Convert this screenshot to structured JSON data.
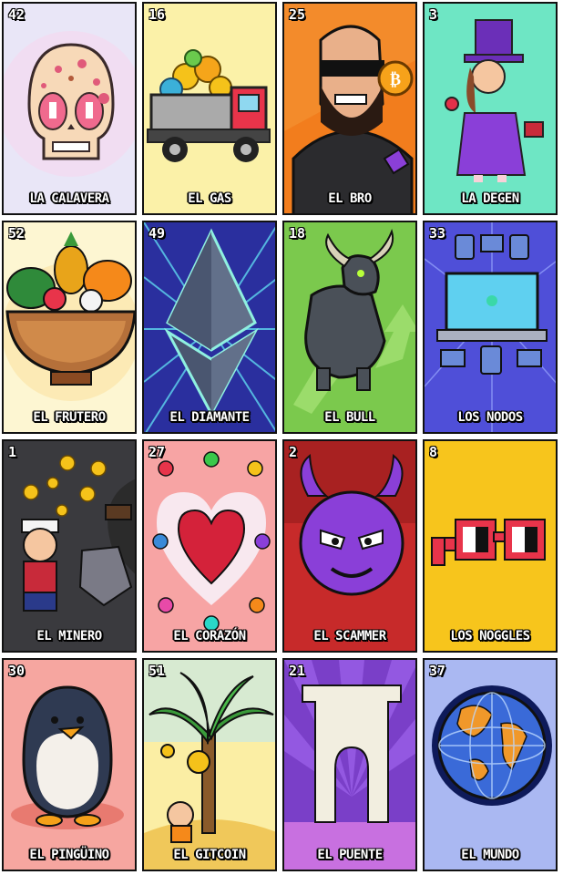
{
  "cards": [
    {
      "number": "42",
      "name": "LA CALAVERA",
      "bg": "#e9e6f7",
      "icon": "skull-icon"
    },
    {
      "number": "16",
      "name": "EL GAS",
      "bg": "#fbf1a8",
      "icon": "truck-icon"
    },
    {
      "number": "25",
      "name": "EL BRO",
      "bg": "#f27d1d",
      "icon": "bro-icon"
    },
    {
      "number": "3",
      "name": "LA DEGEN",
      "bg": "#6ee6c4",
      "icon": "degen-icon"
    },
    {
      "number": "52",
      "name": "EL FRUTERO",
      "bg": "#fdf6d2",
      "icon": "fruit-bowl-icon"
    },
    {
      "number": "49",
      "name": "EL DIAMANTE",
      "bg": "#2a2f9e",
      "icon": "ethereum-diamond-icon"
    },
    {
      "number": "18",
      "name": "EL BULL",
      "bg": "#7bc94d",
      "icon": "bull-icon"
    },
    {
      "number": "33",
      "name": "LOS NODOS",
      "bg": "#4f4fd8",
      "icon": "nodes-icon"
    },
    {
      "number": "1",
      "name": "EL MINERO",
      "bg": "#2b2b2b",
      "icon": "miner-icon"
    },
    {
      "number": "27",
      "name": "EL CORAZÓN",
      "bg": "#f7a4a4",
      "icon": "heart-icon"
    },
    {
      "number": "2",
      "name": "EL SCAMMER",
      "bg": "#c72a2a",
      "icon": "devil-icon"
    },
    {
      "number": "8",
      "name": "LOS NOGGLES",
      "bg": "#f7c51c",
      "icon": "noggles-icon"
    },
    {
      "number": "30",
      "name": "EL PINGÜINO",
      "bg": "#f6a6a0",
      "icon": "penguin-icon"
    },
    {
      "number": "51",
      "name": "EL GITCOIN",
      "bg": "#fbeea4",
      "icon": "palm-tree-icon"
    },
    {
      "number": "21",
      "name": "EL PUENTE",
      "bg": "#7a3fc8",
      "icon": "bridge-icon"
    },
    {
      "number": "37",
      "name": "EL MUNDO",
      "bg": "#aab8f2",
      "icon": "globe-icon"
    }
  ]
}
